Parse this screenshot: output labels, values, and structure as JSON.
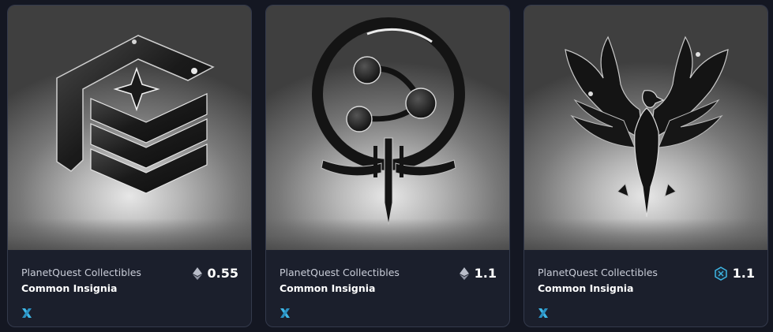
{
  "cards": [
    {
      "collection": "PlanetQuest Collectibles",
      "title": "Common Insignia",
      "price": "0.55",
      "currency_icon": "eth-icon",
      "chain_icon": "immutable-x-icon",
      "art": "insignia-chevron-star"
    },
    {
      "collection": "PlanetQuest Collectibles",
      "title": "Common Insignia",
      "price": "1.1",
      "currency_icon": "eth-icon",
      "chain_icon": "immutable-x-icon",
      "art": "insignia-orb-sword"
    },
    {
      "collection": "PlanetQuest Collectibles",
      "title": "Common Insignia",
      "price": "1.1",
      "currency_icon": "imx-token-icon",
      "chain_icon": "immutable-x-icon",
      "art": "insignia-eagle"
    }
  ],
  "colors": {
    "background": "#141722",
    "card": "#1b1f2c",
    "chain_icon": "#3fb7e6"
  }
}
